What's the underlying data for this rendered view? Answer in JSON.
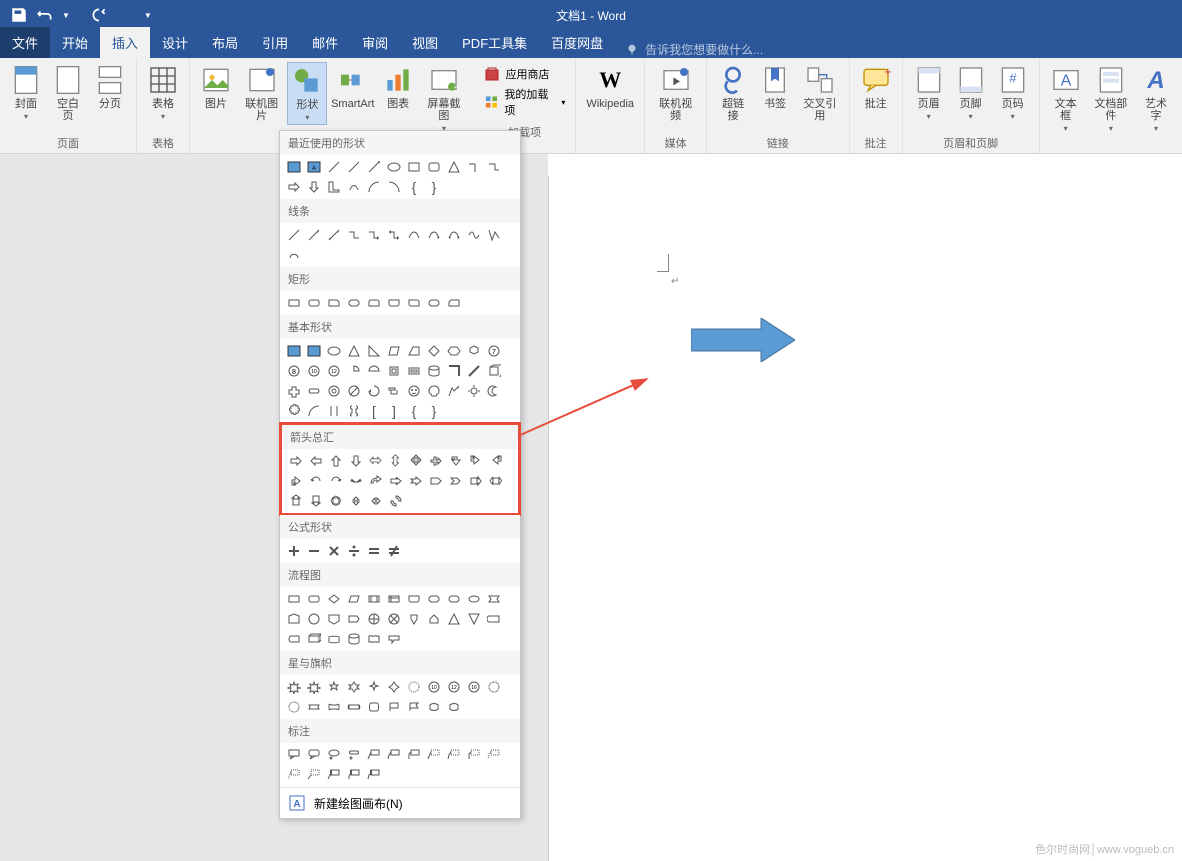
{
  "title": "文档1 - Word",
  "qat": {
    "save": "save",
    "undo": "undo",
    "redo": "redo"
  },
  "tabs": {
    "file": "文件",
    "home": "开始",
    "insert": "插入",
    "design": "设计",
    "layout": "布局",
    "references": "引用",
    "mailings": "邮件",
    "review": "审阅",
    "view": "视图",
    "pdf": "PDF工具集",
    "baidu": "百度网盘"
  },
  "tell_me_placeholder": "告诉我您想要做什么...",
  "ribbon": {
    "pages": {
      "label": "页面",
      "cover": "封面",
      "blank": "空白页",
      "break": "分页"
    },
    "tables": {
      "label": "表格",
      "table": "表格"
    },
    "illustrations": {
      "pictures": "图片",
      "online_pictures": "联机图片",
      "shapes": "形状",
      "smartart": "SmartArt",
      "chart": "图表",
      "screenshot": "屏幕截图"
    },
    "addins": {
      "label": "加载项",
      "store": "应用商店",
      "my_addins": "我的加载项"
    },
    "wikipedia": "Wikipedia",
    "media": {
      "label": "媒体",
      "video": "联机视频"
    },
    "links": {
      "label": "链接",
      "hyperlink": "超链接",
      "bookmark": "书签",
      "crossref": "交叉引用"
    },
    "comments": {
      "label": "批注",
      "comment": "批注"
    },
    "header_footer": {
      "label": "页眉和页脚",
      "header": "页眉",
      "footer": "页脚",
      "page_number": "页码"
    },
    "text": {
      "textbox": "文本框",
      "parts": "文档部件",
      "wordart": "艺术字"
    }
  },
  "shapes_dropdown": {
    "recent": "最近使用的形状",
    "lines": "线条",
    "rectangles": "矩形",
    "basic": "基本形状",
    "block_arrows": "箭头总汇",
    "equation": "公式形状",
    "flowchart": "流程图",
    "stars": "星与旗帜",
    "callouts": "标注",
    "new_canvas": "新建绘图画布(N)"
  },
  "watermark": "色尔时尚网│www.vogueb.cn"
}
